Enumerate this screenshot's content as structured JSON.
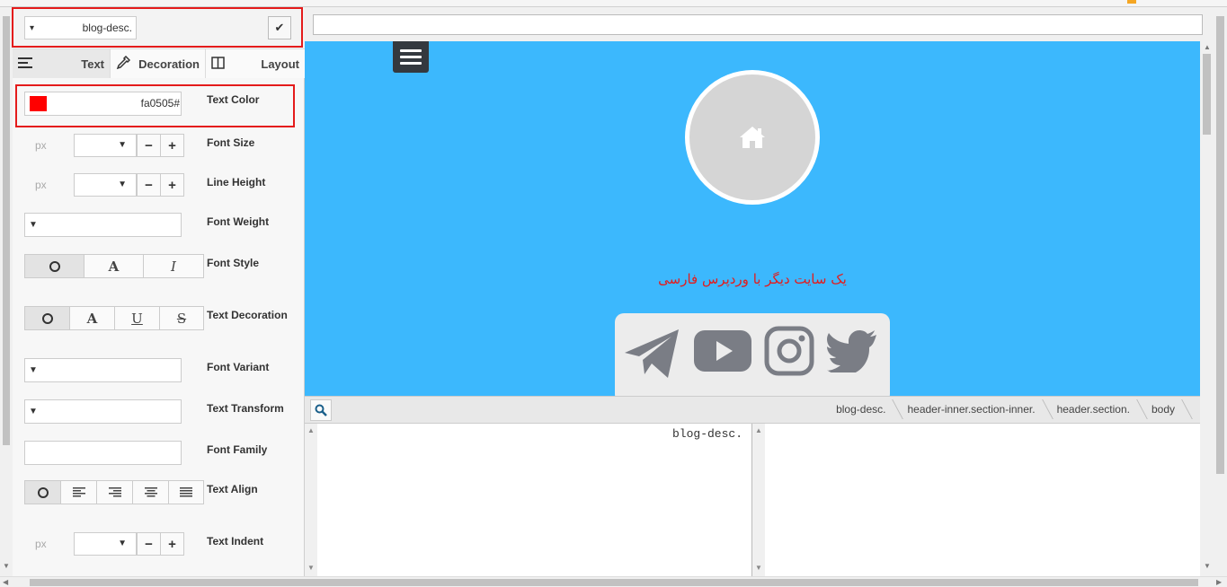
{
  "selector": {
    "value": "blog-desc.",
    "caret": "▾",
    "apply_icon": "check-icon"
  },
  "tabs": [
    {
      "label": "Text",
      "icon": "align-left-icon"
    },
    {
      "label": "Decoration",
      "icon": "eyedropper-icon"
    },
    {
      "label": "Layout",
      "icon": "columns-icon"
    }
  ],
  "props": {
    "text_color": {
      "label": "Text Color",
      "value": "fa0505#",
      "swatch": "#ff0000"
    },
    "font_size": {
      "label": "Font Size",
      "unit": "px",
      "minus": "−",
      "plus": "+"
    },
    "line_height": {
      "label": "Line Height",
      "unit": "px",
      "minus": "−",
      "plus": "+"
    },
    "font_weight": {
      "label": "Font Weight"
    },
    "font_style": {
      "label": "Font Style",
      "options": [
        "A",
        "I"
      ]
    },
    "text_decoration": {
      "label": "Text Decoration",
      "options": [
        "A",
        "U",
        "S"
      ]
    },
    "font_variant": {
      "label": "Font Variant"
    },
    "text_transform": {
      "label": "Text Transform"
    },
    "font_family": {
      "label": "Font Family",
      "value": ""
    },
    "text_align": {
      "label": "Text Align"
    },
    "text_indent": {
      "label": "Text Indent",
      "unit": "px",
      "minus": "−",
      "plus": "+"
    }
  },
  "preview": {
    "url": "",
    "background": "#3cb8fd",
    "blog_description": "یک سایت دیگر با وردپرس فارسی",
    "description_color": "#e41b1b",
    "social_icons": [
      "telegram-icon",
      "youtube-icon",
      "instagram-icon",
      "twitter-icon"
    ]
  },
  "breadcrumb": [
    "blog-desc.",
    "header-inner.section-inner.",
    "header.section.",
    "body"
  ],
  "code": {
    "left": "blog-desc.",
    "right": ""
  }
}
